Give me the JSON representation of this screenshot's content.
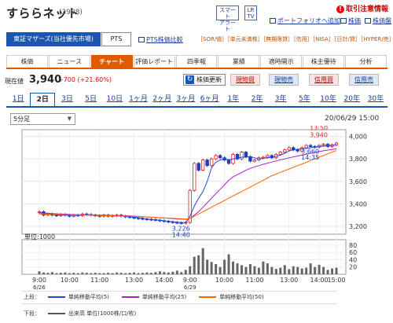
{
  "header": {
    "company_name": "すららネット",
    "code": "(3998)",
    "smart_alert": "スマート\nアラート",
    "lr_tv": "LR\nTV",
    "warning_link": "取引注意情報",
    "portfolio_link": "ポートフォリオへ追加",
    "stock_board": "株価",
    "board": "株価盤"
  },
  "market": {
    "tabs": [
      {
        "label": "東証マザーズ(当社優先市場)",
        "active": true
      },
      {
        "label": "PTS",
        "active": false
      }
    ],
    "pts_compare": "PTS株価比較",
    "tags": "［SOR/値］［単元未満株］［無期限貸］［信用］［NISA］［日計/貸］［HYPER/売］"
  },
  "main_tabs": [
    {
      "label": "株価",
      "active": false
    },
    {
      "label": "ニュース",
      "active": false
    },
    {
      "label": "チャート",
      "active": true
    },
    {
      "label": "評価レポート",
      "active": false
    },
    {
      "label": "四季報",
      "active": false
    },
    {
      "label": "業績",
      "active": false
    },
    {
      "label": "適時開示",
      "active": false
    },
    {
      "label": "株主優待",
      "active": false
    },
    {
      "label": "分析",
      "active": false
    }
  ],
  "price": {
    "label": "現在値",
    "value": "3,940",
    "change": "+700 (+21.60%)",
    "refresh": "株価更新",
    "buy_spot": "現物買",
    "sell_spot": "現物売",
    "buy_margin": "信用買",
    "sell_margin": "信用売"
  },
  "period_tabs": [
    "1日",
    "2日",
    "3日",
    "5日",
    "10日",
    "1ヶ月",
    "2ヶ月",
    "3ヶ月",
    "6ヶ月",
    "1年",
    "2年",
    "3年",
    "5年",
    "10年",
    "20年",
    "30年"
  ],
  "period_active": "2日",
  "interval": "5分足",
  "chart_date": "20/06/29 15:00",
  "chart_data": {
    "type": "candlestick",
    "price_axis": {
      "ticks": [
        "4,000",
        "3,800",
        "3,600",
        "3,400",
        "3,200"
      ],
      "values": [
        4000,
        3800,
        3600,
        3400,
        3200
      ],
      "range": [
        3130,
        4060
      ]
    },
    "volume_axis": {
      "ticks": [
        "80",
        "60",
        "40",
        "20"
      ],
      "values": [
        80,
        60,
        40,
        20
      ],
      "range": [
        0,
        95
      ],
      "unit_label": "単位:1000"
    },
    "x_ticks": [
      "9:00",
      "10:00",
      "11:00",
      "13:00",
      "14:00",
      "9:00",
      "10:00",
      "11:00",
      "13:00",
      "14:00",
      "15:00"
    ],
    "x_dates": [
      "6/26",
      "6/29"
    ],
    "annotations": {
      "high": {
        "time": "13:50",
        "value": "3,940"
      },
      "low": {
        "time": "14:40",
        "value": "3,226"
      },
      "ma_point": {
        "time": "14:35",
        "value": "3,660"
      }
    },
    "close": [
      3330,
      3300,
      3310,
      3300,
      3295,
      3305,
      3300,
      3290,
      3300,
      3295,
      3310,
      3305,
      3300,
      3295,
      3290,
      3300,
      3290,
      3295,
      3300,
      3290,
      3285,
      3280,
      3275,
      3270,
      3265,
      3262,
      3260,
      3255,
      3250,
      3245,
      3240,
      3235,
      3232,
      3228,
      3235,
      3520,
      3760,
      3700,
      3790,
      3740,
      3800,
      3830,
      3810,
      3790,
      3760,
      3840,
      3800,
      3860,
      3820,
      3780,
      3790,
      3810,
      3815,
      3830,
      3810,
      3840,
      3860,
      3880,
      3900,
      3880,
      3870,
      3900,
      3920,
      3910,
      3905,
      3920,
      3930,
      3910,
      3925,
      3940
    ],
    "volume": [
      8,
      5,
      4,
      6,
      3,
      4,
      5,
      3,
      4,
      3,
      5,
      4,
      3,
      4,
      3,
      3,
      4,
      3,
      5,
      4,
      3,
      4,
      5,
      3,
      4,
      5,
      4,
      6,
      8,
      6,
      5,
      7,
      10,
      6,
      12,
      22,
      48,
      52,
      72,
      40,
      34,
      28,
      20,
      40,
      55,
      35,
      30,
      25,
      20,
      28,
      22,
      18,
      35,
      30,
      20,
      15,
      18,
      25,
      14,
      22,
      20,
      16,
      18,
      30,
      20,
      26,
      20,
      12,
      16,
      18
    ],
    "ma5": [
      3325,
      3318,
      3312,
      3307,
      3302,
      3300,
      3299,
      3298,
      3298,
      3298,
      3300,
      3302,
      3303,
      3301,
      3298,
      3297,
      3296,
      3295,
      3295,
      3293,
      3290,
      3286,
      3282,
      3277,
      3271,
      3266,
      3262,
      3258,
      3254,
      3249,
      3245,
      3240,
      3237,
      3234,
      3233,
      3290,
      3380,
      3450,
      3510,
      3600,
      3720,
      3770,
      3790,
      3800,
      3790,
      3800,
      3805,
      3815,
      3815,
      3820,
      3810,
      3800,
      3805,
      3810,
      3815,
      3822,
      3835,
      3850,
      3870,
      3880,
      3885,
      3890,
      3895,
      3900,
      3905,
      3910,
      3915,
      3918,
      3920,
      3925
    ],
    "ma25": [
      3320,
      3318,
      3316,
      3314,
      3312,
      3310,
      3308,
      3306,
      3305,
      3304,
      3303,
      3302,
      3302,
      3301,
      3300,
      3299,
      3298,
      3297,
      3296,
      3295,
      3294,
      3292,
      3290,
      3288,
      3286,
      3284,
      3281,
      3279,
      3276,
      3274,
      3271,
      3268,
      3266,
      3264,
      3262,
      3270,
      3300,
      3330,
      3370,
      3410,
      3450,
      3490,
      3530,
      3570,
      3610,
      3640,
      3660,
      3680,
      3700,
      3715,
      3730,
      3740,
      3752,
      3762,
      3772,
      3782,
      3792,
      3800,
      3810,
      3818,
      3826,
      3834,
      3842,
      3850,
      3858,
      3865,
      3872,
      3878,
      3884,
      3890
    ],
    "ma50": [
      3310,
      3309,
      3308,
      3307,
      3306,
      3305,
      3304,
      3303,
      3302,
      3301,
      3300,
      3299,
      3298,
      3297,
      3296,
      3295,
      3294,
      3293,
      3292,
      3291,
      3290,
      3289,
      3288,
      3287,
      3285,
      3283,
      3281,
      3279,
      3277,
      3275,
      3273,
      3271,
      3269,
      3267,
      3265,
      3270,
      3290,
      3310,
      3330,
      3350,
      3370,
      3390,
      3410,
      3430,
      3450,
      3470,
      3490,
      3510,
      3530,
      3550,
      3570,
      3590,
      3610,
      3630,
      3650,
      3665,
      3680,
      3695,
      3710,
      3725,
      3740,
      3755,
      3770,
      3785,
      3800,
      3815,
      3830,
      3845,
      3860,
      3875
    ],
    "legend_upper": [
      {
        "name": "単純移動平均(5)",
        "color": "#2244dd"
      },
      {
        "name": "単純移動平均(25)",
        "color": "#aa22cc"
      },
      {
        "name": "単純移動平均(50)",
        "color": "#ff6600"
      }
    ],
    "legend_lower": [
      {
        "name": "出来高 単位(1000株/口/枚)",
        "color": "#555555"
      }
    ],
    "upper_label": "上段：",
    "lower_label": "下段："
  }
}
